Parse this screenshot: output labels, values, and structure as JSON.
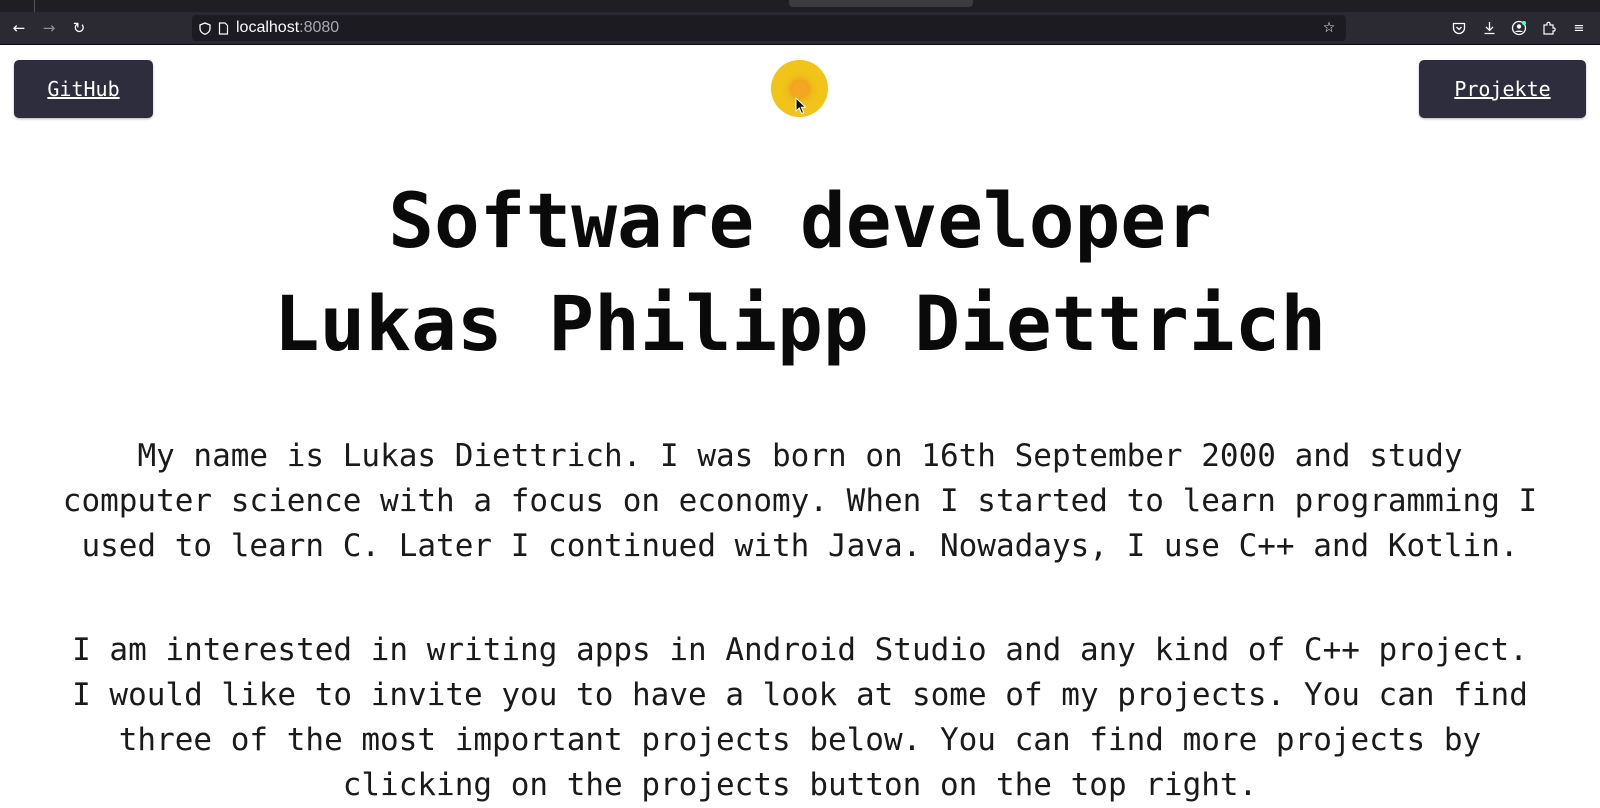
{
  "browser": {
    "url_host": "localhost",
    "url_port": ":8080",
    "icons": {
      "back": "back-arrow-icon",
      "forward": "forward-arrow-icon",
      "reload": "reload-icon",
      "shield": "shield-icon",
      "page": "page-icon",
      "bookmark": "star-icon",
      "pocket": "pocket-icon",
      "downloads": "download-icon",
      "account": "account-icon",
      "extensions": "extensions-icon",
      "menu": "hamburger-menu-icon"
    }
  },
  "header": {
    "github_label": "GitHub",
    "projects_label": "Projekte",
    "theme_toggle_icon": "sun-icon",
    "colors": {
      "button_bg": "#2d2d3d",
      "toggle_bg": "#f0c419"
    }
  },
  "hero": {
    "title_line1": "Software developer",
    "title_line2": "Lukas Philipp Diettrich"
  },
  "about": {
    "paragraph1": "My name is Lukas Diettrich. I was born on 16th September 2000 and study computer science with a focus on economy. When I started to learn programming I used to learn C. Later I continued with Java. Nowadays, I use C++ and Kotlin.",
    "paragraph2": "I am interested in writing apps in Android Studio and any kind of C++ project. I would like to invite you to have a look at some of my projects. You can find three of the most important projects below. You can find more projects by clicking on the projects button on the top right."
  }
}
